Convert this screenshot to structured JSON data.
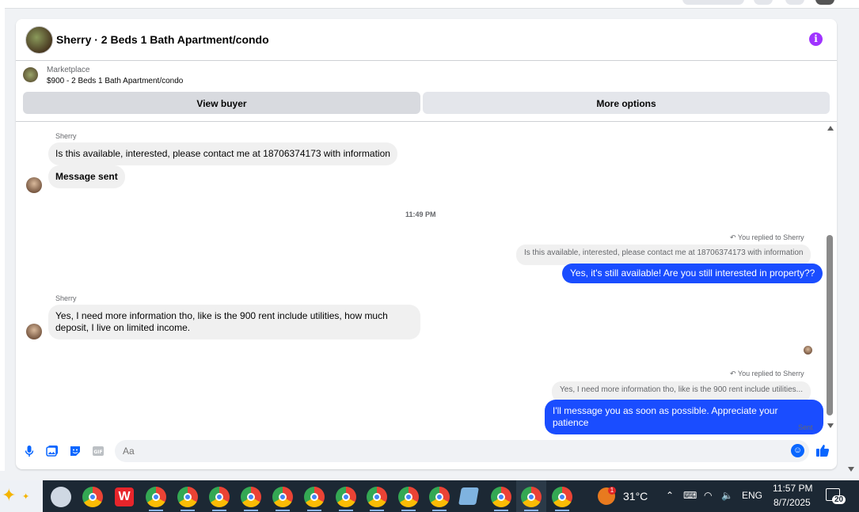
{
  "header": {
    "title": "Sherry · 2 Beds 1 Bath Apartment/condo",
    "info_icon": "info-icon"
  },
  "listing": {
    "source": "Marketplace",
    "price_title": "$900 - 2 Beds 1 Bath Apartment/condo",
    "view_buyer": "View buyer",
    "more_options": "More options"
  },
  "thread": {
    "msg1_sender": "Sherry",
    "msg1_text": "Is this available, interested, please contact me at 18706374173 with information",
    "msg2_text": "Message sent",
    "timestamp": "11:49 PM",
    "reply1_label": "You replied to Sherry",
    "reply1_quote": "Is this available, interested, please contact me at 18706374173 with information",
    "reply1_text": "Yes, it's still available! Are you still interested in property??",
    "msg3_sender": "Sherry",
    "msg3_text": "Yes, I need more information tho, like is the 900 rent include utilities, how much deposit, I live on limited income.",
    "reply2_label": "You replied to Sherry",
    "reply2_quote": "Yes, I need more information tho, like is the 900 rent include utilities...",
    "reply2_text": "I'll message you as soon as possible. Appreciate your patience",
    "status": "Sent"
  },
  "composer": {
    "placeholder": "Aa",
    "icons": [
      "microphone-icon",
      "photo-icon",
      "sticker-icon",
      "gif-icon",
      "emoji-icon",
      "like-icon"
    ]
  },
  "taskbar": {
    "temperature": "31°C",
    "weather_badge": "1",
    "wps_label": "W",
    "language": "ENG",
    "time": "11:57 PM",
    "date": "8/7/2025",
    "notification_count": "20"
  },
  "colors": {
    "accent": "#0866ff",
    "outgoing_bubble": "#1a4dff",
    "incoming_bubble": "#f0f0f0",
    "info": "#a033ff",
    "taskbar": "#1c2834"
  }
}
